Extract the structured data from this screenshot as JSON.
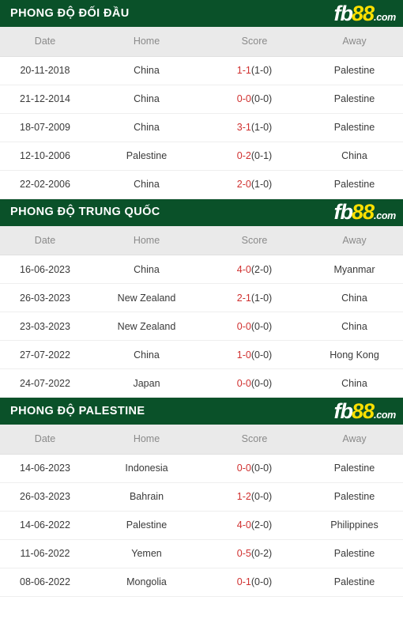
{
  "logo": {
    "part_white": "fb",
    "part_yellow": "88",
    "part_domain": ".com"
  },
  "columns": {
    "date": "Date",
    "home": "Home",
    "score": "Score",
    "away": "Away"
  },
  "sections": [
    {
      "title": "PHONG ĐỘ ĐỐI ĐẦU",
      "rows": [
        {
          "date": "20-11-2018",
          "home": "China",
          "home_style": "orange",
          "score_main": "1-1",
          "score_ht": "(1-0)",
          "away": "Palestine",
          "away_style": "plain"
        },
        {
          "date": "21-12-2014",
          "home": "China",
          "home_style": "orange",
          "score_main": "0-0",
          "score_ht": "(0-0)",
          "away": "Palestine",
          "away_style": "plain"
        },
        {
          "date": "18-07-2009",
          "home": "China",
          "home_style": "orange",
          "score_main": "3-1",
          "score_ht": "(1-0)",
          "away": "Palestine",
          "away_style": "plain"
        },
        {
          "date": "12-10-2006",
          "home": "Palestine",
          "home_style": "plain",
          "score_main": "0-2",
          "score_ht": "(0-1)",
          "away": "China",
          "away_style": "orange"
        },
        {
          "date": "22-02-2006",
          "home": "China",
          "home_style": "orange",
          "score_main": "2-0",
          "score_ht": "(1-0)",
          "away": "Palestine",
          "away_style": "plain"
        }
      ]
    },
    {
      "title": "PHONG ĐỘ TRUNG QUỐC",
      "rows": [
        {
          "date": "16-06-2023",
          "home": "China",
          "home_style": "orange",
          "score_main": "4-0",
          "score_ht": "(2-0)",
          "away": "Myanmar",
          "away_style": "plain"
        },
        {
          "date": "26-03-2023",
          "home": "New Zealand",
          "home_style": "plain",
          "score_main": "2-1",
          "score_ht": "(1-0)",
          "away": "China",
          "away_style": "orange"
        },
        {
          "date": "23-03-2023",
          "home": "New Zealand",
          "home_style": "plain",
          "score_main": "0-0",
          "score_ht": "(0-0)",
          "away": "China",
          "away_style": "orange"
        },
        {
          "date": "27-07-2022",
          "home": "China",
          "home_style": "orange",
          "score_main": "1-0",
          "score_ht": "(0-0)",
          "away": "Hong Kong",
          "away_style": "plain"
        },
        {
          "date": "24-07-2022",
          "home": "Japan",
          "home_style": "plain",
          "score_main": "0-0",
          "score_ht": "(0-0)",
          "away": "China",
          "away_style": "orange"
        }
      ]
    },
    {
      "title": "PHONG ĐỘ PALESTINE",
      "rows": [
        {
          "date": "14-06-2023",
          "home": "Indonesia",
          "home_style": "plain",
          "score_main": "0-0",
          "score_ht": "(0-0)",
          "away": "Palestine",
          "away_style": "blue"
        },
        {
          "date": "26-03-2023",
          "home": "Bahrain",
          "home_style": "plain",
          "score_main": "1-2",
          "score_ht": "(0-0)",
          "away": "Palestine",
          "away_style": "blue"
        },
        {
          "date": "14-06-2022",
          "home": "Palestine",
          "home_style": "blue",
          "score_main": "4-0",
          "score_ht": "(2-0)",
          "away": "Philippines",
          "away_style": "plain"
        },
        {
          "date": "11-06-2022",
          "home": "Yemen",
          "home_style": "plain",
          "score_main": "0-5",
          "score_ht": "(0-2)",
          "away": "Palestine",
          "away_style": "blue"
        },
        {
          "date": "08-06-2022",
          "home": "Mongolia",
          "home_style": "plain",
          "score_main": "0-1",
          "score_ht": "(0-0)",
          "away": "Palestine",
          "away_style": "blue"
        }
      ]
    }
  ],
  "colors": {
    "header_green": "#0a5129",
    "logo_yellow": "#ffe000",
    "score_red": "#d0302f",
    "team_orange": "#e8a06a",
    "team_blue": "#5b9bd5",
    "column_header_bg": "#eaeaea"
  }
}
